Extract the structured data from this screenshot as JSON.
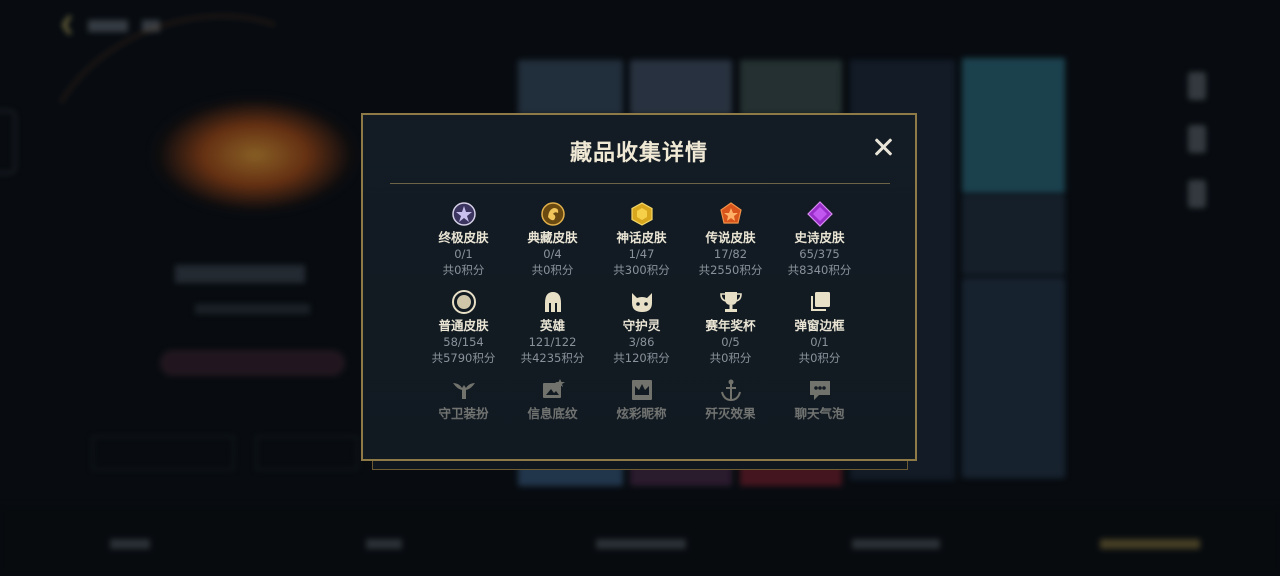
{
  "modal": {
    "title": "藏品收集详情",
    "close_icon": "close-icon"
  },
  "items": [
    {
      "label": "终极皮肤",
      "count": "0/1",
      "points": "共0积分",
      "icon": "ultimate-skin-icon"
    },
    {
      "label": "典藏皮肤",
      "count": "0/4",
      "points": "共0积分",
      "icon": "prestige-skin-icon"
    },
    {
      "label": "神话皮肤",
      "count": "1/47",
      "points": "共300积分",
      "icon": "mythic-skin-icon"
    },
    {
      "label": "传说皮肤",
      "count": "17/82",
      "points": "共2550积分",
      "icon": "legendary-skin-icon"
    },
    {
      "label": "史诗皮肤",
      "count": "65/375",
      "points": "共8340积分",
      "icon": "epic-skin-icon"
    },
    {
      "label": "普通皮肤",
      "count": "58/154",
      "points": "共5790积分",
      "icon": "standard-skin-icon"
    },
    {
      "label": "英雄",
      "count": "121/122",
      "points": "共4235积分",
      "icon": "champion-helmet-icon"
    },
    {
      "label": "守护灵",
      "count": "3/86",
      "points": "共120积分",
      "icon": "little-legend-icon"
    },
    {
      "label": "赛年奖杯",
      "count": "0/5",
      "points": "共0积分",
      "icon": "season-trophy-icon"
    },
    {
      "label": "弹窗边框",
      "count": "0/1",
      "points": "共0积分",
      "icon": "popup-frame-icon"
    },
    {
      "label": "守卫装扮",
      "icon": "ward-skin-icon"
    },
    {
      "label": "信息底纹",
      "icon": "info-pattern-icon"
    },
    {
      "label": "炫彩昵称",
      "icon": "chroma-name-icon"
    },
    {
      "label": "歼灭效果",
      "icon": "annihilate-effect-icon"
    },
    {
      "label": "聊天气泡",
      "icon": "chat-bubble-icon"
    }
  ],
  "colors": {
    "accent_gold": "#8e7a47",
    "modal_bg": "#131c24",
    "label_text": "#e9e4d4",
    "sub_text": "#8a919a"
  }
}
